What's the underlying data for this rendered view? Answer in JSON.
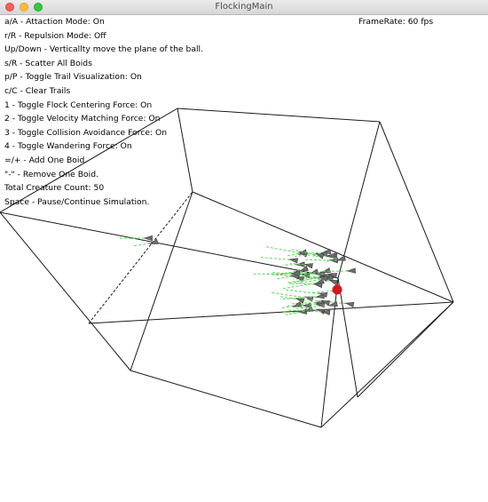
{
  "window": {
    "title": "FlockingMain"
  },
  "hud": {
    "framerate": "FrameRate: 60 fps",
    "lines": [
      "a/A - Attaction Mode: On",
      "r/R - Repulsion Mode: Off",
      "Up/Down - Verticallty move the plane of the ball.",
      "s/R - Scatter All Boids",
      "p/P - Toggle Trail Visualization: On",
      "c/C - Clear Trails",
      "1 - Toggle Flock Centering Force: On",
      "2 - Toggle Velocity Matching Force: On",
      "3 - Toggle Collision Avoidance Force: On",
      "4 - Toggle Wandering Force: On",
      "=/+ - Add One Boid.",
      "\"-\" - Remove One Boid.",
      "Total Creature Count: 50",
      "Space - Pause/Continue Simulation."
    ]
  },
  "scene": {
    "boid_count": 50,
    "colors": {
      "edges": "#1a1a1a",
      "trail": "#5fd35f",
      "boid": "#6e6e6e",
      "ball": "#d11a1a"
    }
  }
}
